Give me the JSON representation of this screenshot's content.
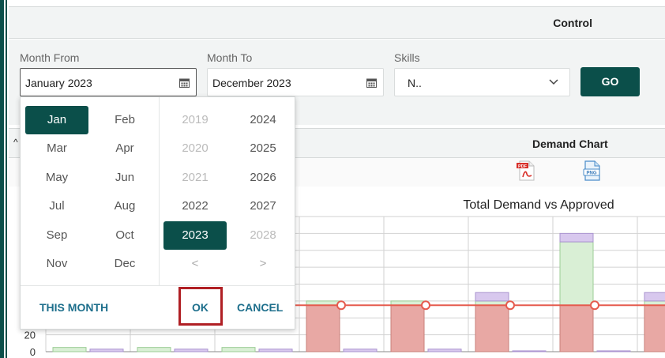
{
  "control": {
    "title": "Control"
  },
  "filters": {
    "month_from": {
      "label": "Month From",
      "value": "January 2023"
    },
    "month_to": {
      "label": "Month To",
      "value": "December 2023"
    },
    "skills": {
      "label": "Skills",
      "value": "N.."
    },
    "go_label": "GO"
  },
  "picker": {
    "months": [
      "Jan",
      "Feb",
      "Mar",
      "Apr",
      "May",
      "Jun",
      "Jul",
      "Aug",
      "Sep",
      "Oct",
      "Nov",
      "Dec"
    ],
    "selected_month": "Jan",
    "years": [
      "2019",
      "2024",
      "2020",
      "2025",
      "2021",
      "2026",
      "2022",
      "2027",
      "2023",
      "2028"
    ],
    "selected_year": "2023",
    "prev": "<",
    "next": ">",
    "this_month": "THIS MONTH",
    "ok": "OK",
    "cancel": "CANCEL"
  },
  "demand": {
    "title": "Demand Chart",
    "pdf_icon": "pdf-icon",
    "png_icon": "png-icon"
  },
  "chart_data": {
    "type": "bar",
    "title": "Total Demand vs Approved",
    "yticks": [
      "0",
      "20"
    ],
    "ylim": [
      0,
      160
    ],
    "series": [
      {
        "values": [
          5,
          5,
          5,
          60,
          60,
          60,
          130,
          60
        ]
      },
      {
        "values": [
          2,
          2,
          2,
          0,
          0,
          10,
          10,
          10
        ]
      },
      {
        "values": [
          3,
          3,
          3,
          3,
          3,
          1,
          1,
          0
        ]
      },
      {
        "values": [
          0,
          0,
          0,
          55,
          55,
          55,
          55,
          55
        ]
      }
    ],
    "colors": {
      "green": "#d9efd5",
      "purple": "#d8c8ee",
      "red": "#e8a8a4",
      "line": "#e55b4e"
    }
  }
}
